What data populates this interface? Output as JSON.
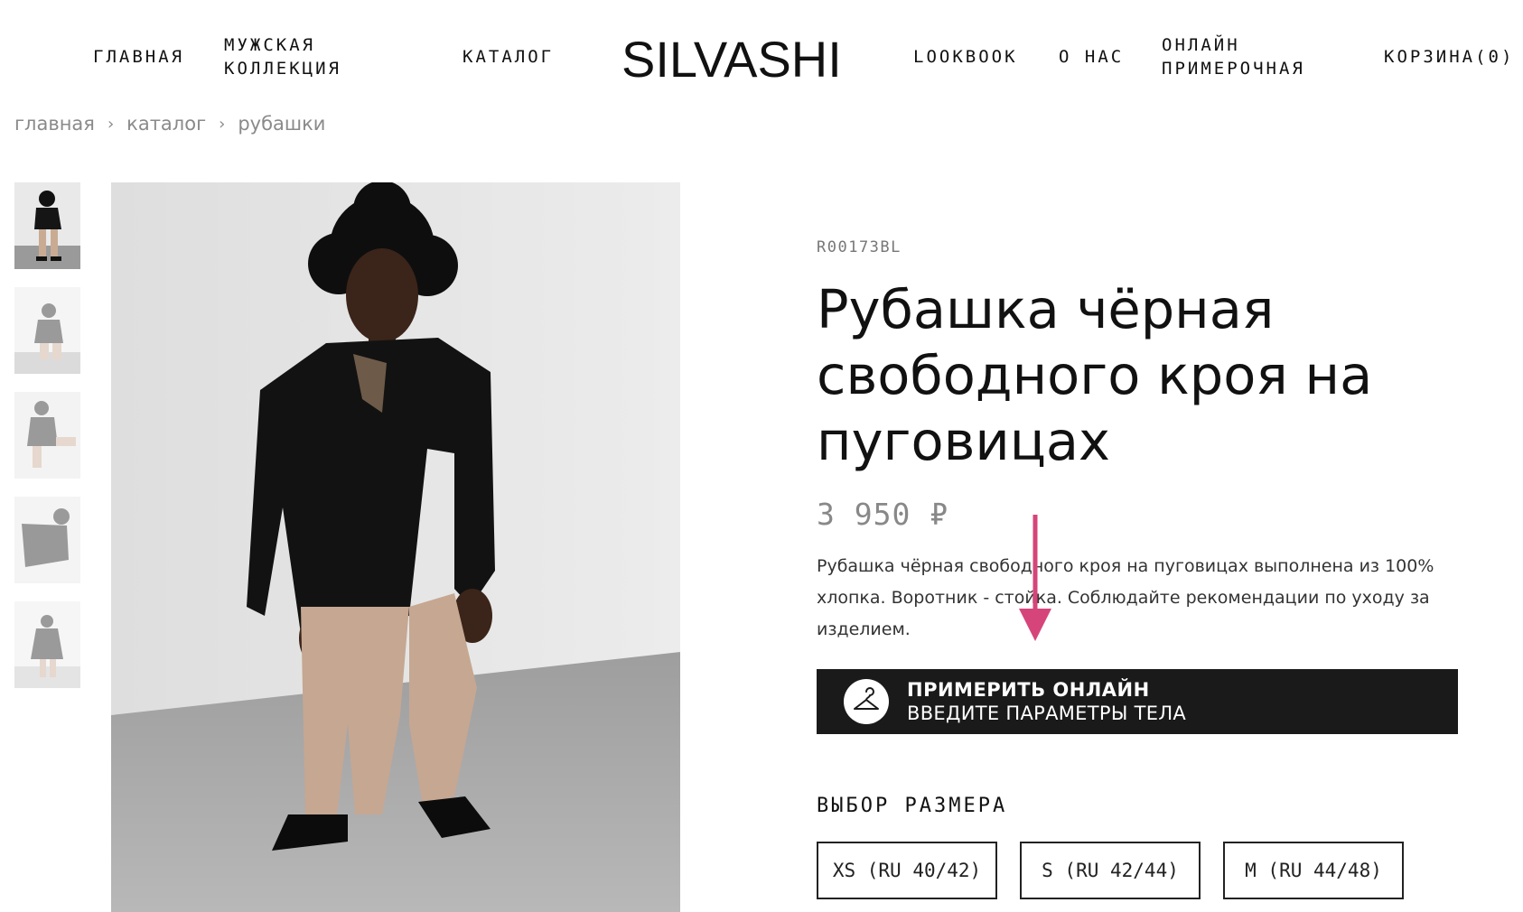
{
  "nav": {
    "home": "ГЛАВНАЯ",
    "mens_line1": "МУЖСКАЯ",
    "mens_line2": "КОЛЛЕКЦИЯ",
    "catalog": "КАТАЛОГ",
    "logo": "SILVASHI",
    "lookbook": "LOOKBOOK",
    "about": "О НАС",
    "fitting_line1": "ОНЛАЙН",
    "fitting_line2": "ПРИМЕРОЧНАЯ",
    "cart": "КОРЗИНА(0)"
  },
  "breadcrumb": {
    "items": [
      "главная",
      "каталог",
      "рубашки"
    ],
    "separator": "›"
  },
  "product": {
    "sku": "R00173BL",
    "title_line1": "Рубашка чёрная",
    "title_line2": "свободного кроя на",
    "title_line3": "пуговицах",
    "price": "3 950 ₽",
    "description": "Рубашка чёрная свободного кроя на пуговицах выполнена из 100% хлопка. Воротник - стойка. Соблюдайте рекомендации по уходу за изделием."
  },
  "tryon": {
    "line1": "ПРИМЕРИТЬ ОНЛАЙН",
    "line2": "ВВЕДИТЕ ПАРАМЕТРЫ ТЕЛА",
    "icon": "hanger-icon"
  },
  "sizes": {
    "title": "ВЫБОР РАЗМЕРА",
    "options": [
      "XS (RU 40/42)",
      "S (RU 42/44)",
      "M (RU 44/48)"
    ]
  },
  "colors": {
    "accent_arrow": "#d6457a",
    "button_bg": "#1a1a1a"
  }
}
